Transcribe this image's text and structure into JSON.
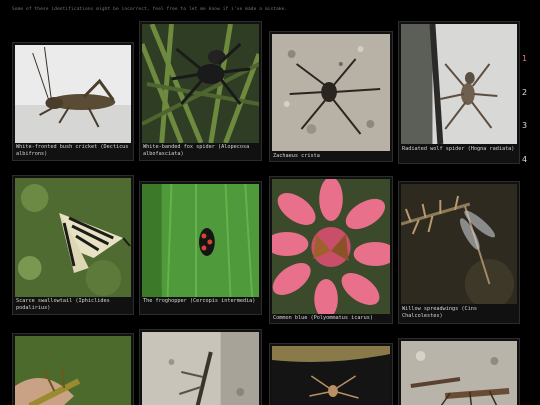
{
  "notice": "Some of these identifications might be incorrect, feel free to let me know if i've made a mistake.",
  "colors": {
    "background": "#000000",
    "card": "#111111",
    "active_page": "#e0806a"
  },
  "cards": [
    {
      "caption": "White-fronted bush cricket (Decticus albifrons)",
      "icon": "cricket-photo"
    },
    {
      "caption": "White-banded fox spider (Alopecosa albofasciata)",
      "icon": "spider-photo"
    },
    {
      "caption": "Zachaeus crista",
      "icon": "spider-photo"
    },
    {
      "caption": "Radiated wolf spider (Hogna radiata)",
      "icon": "spider-photo"
    },
    {
      "caption": "Scarce swallowtail (Iphiclides podalirius)",
      "icon": "butterfly-photo"
    },
    {
      "caption": "The froghopper (Cercopis intermedia)",
      "icon": "beetle-photo"
    },
    {
      "caption": "Common blue (Polyommatus icarus)",
      "icon": "butterfly-photo"
    },
    {
      "caption": "Willow spreadwings (Cins Chalcolestes)",
      "icon": "damselfly-photo"
    },
    {
      "caption": "",
      "icon": "insect-photo"
    },
    {
      "caption": "",
      "icon": "insect-photo"
    },
    {
      "caption": "",
      "icon": "spider-photo"
    },
    {
      "caption": "",
      "icon": "insect-photo"
    }
  ],
  "pagination": {
    "pages": [
      "1",
      "2",
      "3",
      "4"
    ],
    "current": "1"
  }
}
